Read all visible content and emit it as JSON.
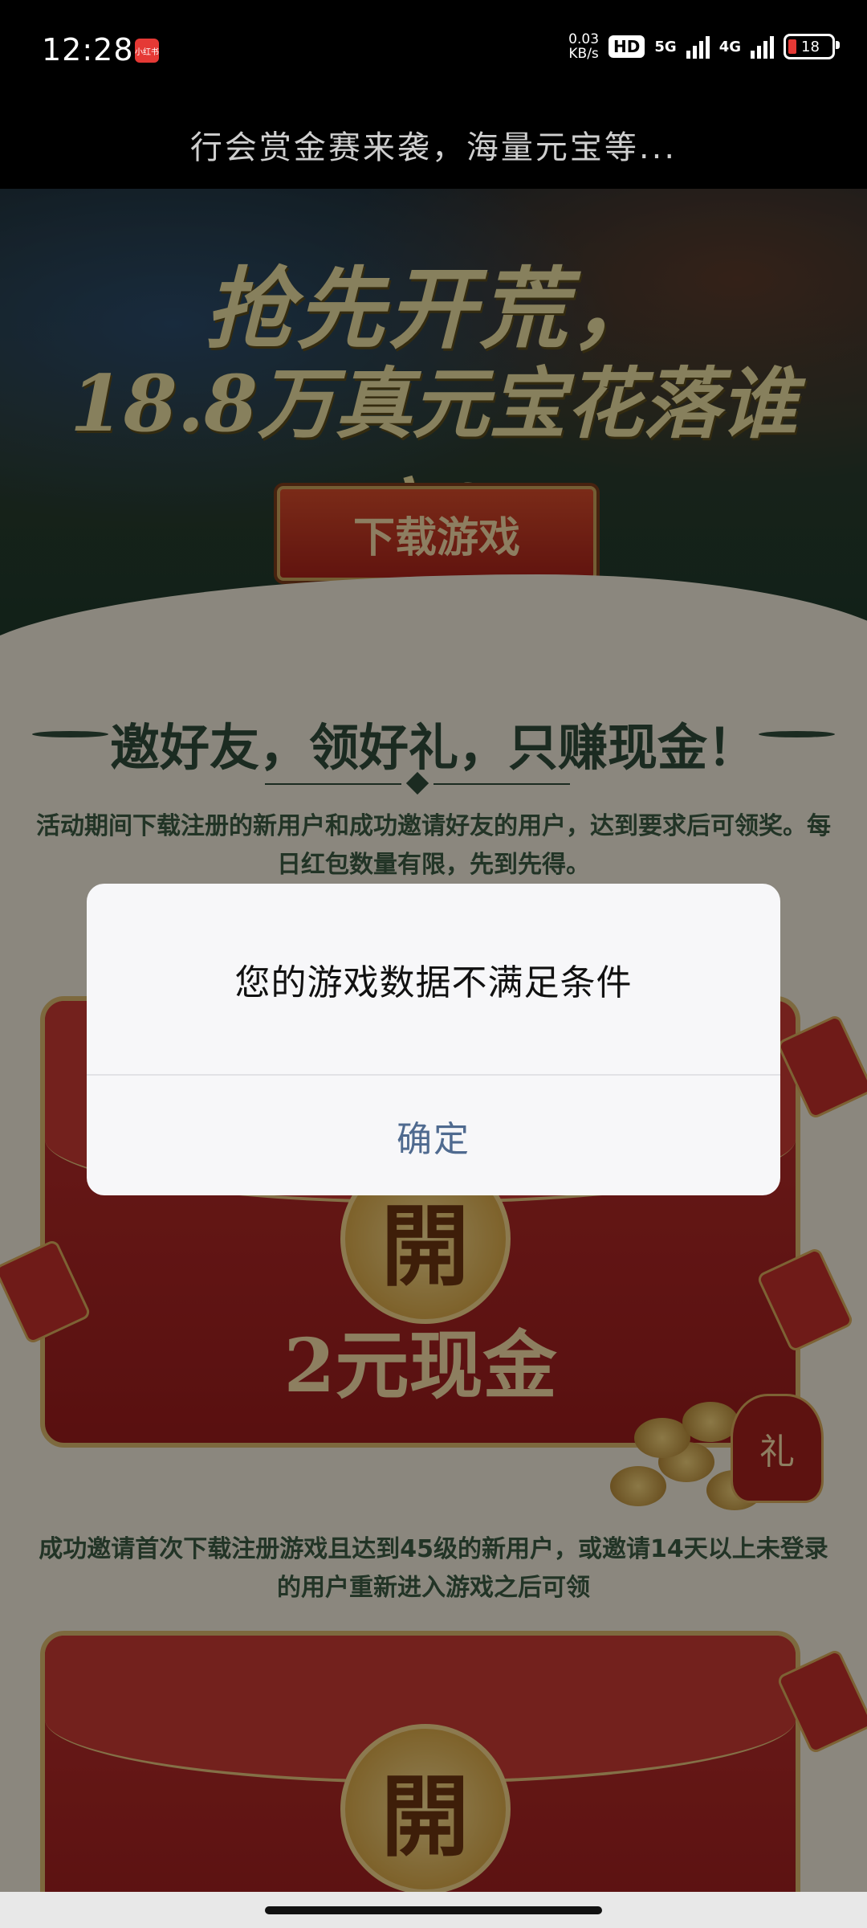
{
  "status_bar": {
    "time": "12:28",
    "app_icon_label": "小红书",
    "net_speed_top": "0.03",
    "net_speed_bottom": "KB/s",
    "hd_badge": "HD",
    "network_5g": "5G",
    "network_4g": "4G",
    "battery": "18"
  },
  "header": {
    "title": "行会赏金赛来袭，海量元宝等..."
  },
  "page": {
    "hero_line1": "抢先开荒，",
    "hero_line2": "18.8万真元宝花落谁家？",
    "download_button": "下载游戏",
    "slogan": "邀好友，领好礼，只赚现金！",
    "rule_text_1": "活动期间下载注册的新用户和成功邀请好友的用户，达到要求后可领奖。每日红包数量有限，先到先得。",
    "envelope_1_coin": "開",
    "envelope_1_amount": "2元现金",
    "gift_bag_label": "礼",
    "rule_text_2": "成功邀请首次下载注册游戏且达到45级的新用户，或邀请14天以上未登录的用户重新进入游戏之后可领",
    "envelope_2_coin": "開"
  },
  "dialog": {
    "message": "您的游戏数据不满足条件",
    "confirm_label": "确定"
  },
  "colors": {
    "dialog_button": "#4f6a8f",
    "envelope_red": "#b9302c",
    "gold": "#d8b56c",
    "slogan_green": "#2f4b3a"
  }
}
